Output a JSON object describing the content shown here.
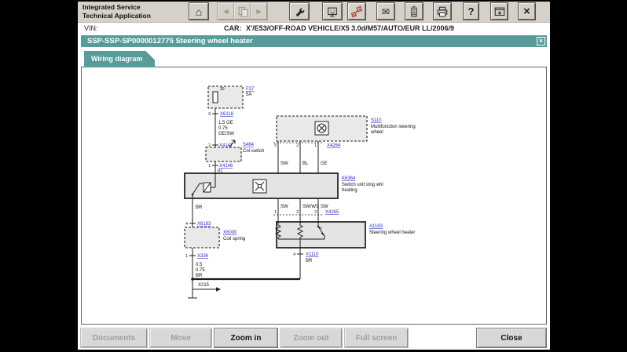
{
  "colors": {
    "teal": "#579b9b",
    "chrome": "#d5d1c9",
    "link_blue": "#2b2bc4",
    "icon_red": "#a8352c"
  },
  "app": {
    "title_line1": "Integrated Service",
    "title_line2": "Technical Application"
  },
  "vin_bar": {
    "vin_label": "VIN:",
    "car_label": "CAR:",
    "car_value": "X'/E53/OFF-ROAD VEHICLE/X5 3.0d/M57/AUTO/EUR LL/2006/9"
  },
  "toolbar": {
    "home_glyph": "⌂",
    "back_glyph": "◀",
    "forward_glyph": "▶",
    "mail_glyph": "✉",
    "help_glyph": "?",
    "close_glyph": "×"
  },
  "window": {
    "title": "SSP-SSP-SP0000012775 Steering wheel heater",
    "close_glyph": "×"
  },
  "tab": {
    "label": "Wiring diagram"
  },
  "action_bar": {
    "buttons": [
      {
        "label": "Documents",
        "enabled": false
      },
      {
        "label": "Move",
        "enabled": false
      },
      {
        "label": "Zoom in",
        "enabled": true
      },
      {
        "label": "Zoom out",
        "enabled": false
      },
      {
        "label": "Full screen",
        "enabled": false
      },
      {
        "label": "Close",
        "enabled": true
      }
    ]
  },
  "diagram": {
    "fuse": {
      "pin": "30",
      "name": "F37",
      "amp": "5A"
    },
    "conn_a": {
      "pin": "9",
      "label": "X6118"
    },
    "feed_wire": [
      "1.5 GE",
      "0.75",
      "GE/SW"
    ],
    "conn_b": {
      "pin": "2",
      "label": "X4147"
    },
    "col_switch": {
      "label": "S464",
      "name": "Col switch"
    },
    "conn_c": {
      "pin": "1",
      "label": "X4146",
      "wire": "R1"
    },
    "control_unit": {
      "label": "K6364",
      "name1": "Switch unit stng whl",
      "name2": "heating"
    },
    "msw": {
      "label": "S110",
      "name1": "Multifunction steering",
      "name2": "wheel",
      "pins": [
        "5",
        "2",
        "1"
      ],
      "conn": "X4264",
      "wires": [
        "SW",
        "BL",
        "GE"
      ]
    },
    "heater_feed": {
      "pins": [
        "1",
        "2",
        "3"
      ],
      "conn": "X4265",
      "wires": [
        "SW",
        "SW/WS",
        "SW"
      ]
    },
    "heater": {
      "label": "A1183",
      "name": "Steering wheel heater",
      "pin": "4",
      "conn": "X1110",
      "wire": "BR"
    },
    "ground": {
      "wire": "BR",
      "conn1_pin": "4",
      "conn1": "X6183",
      "coil_label": "X6000",
      "coil_name": "Coil spring",
      "conn2_pin": "1",
      "conn2": "X336",
      "spec": [
        "0.5",
        "0.75",
        "BR"
      ],
      "ref": "X215"
    }
  }
}
